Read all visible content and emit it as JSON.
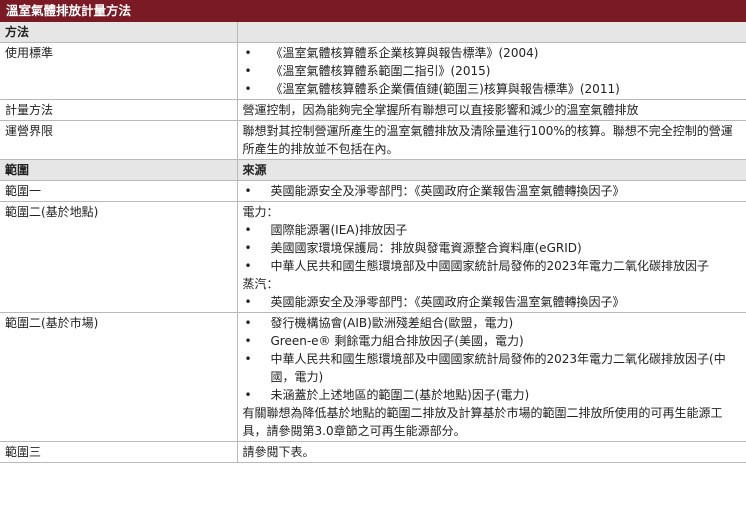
{
  "title": "溫室氣體排放計量方法",
  "sections": [
    {
      "type": "header",
      "col1": "方法",
      "col2": ""
    },
    {
      "type": "row",
      "col1": "使用標準",
      "bullets": [
        "《溫室氣體核算體系企業核算與報告標準》(2004)",
        "《溫室氣體核算體系範圍二指引》(2015)",
        "《溫室氣體核算體系企業價值鏈(範圍三)核算與報告標準》(2011)"
      ]
    },
    {
      "type": "row",
      "col1": "計量方法",
      "text": "營運控制，因為能夠完全掌握所有聯想可以直接影響和減少的溫室氣體排放"
    },
    {
      "type": "row",
      "col1": "運營界限",
      "text": "聯想對其控制營運所產生的溫室氣體排放及清除量進行100%的核算。聯想不完全控制的營運所產生的排放並不包括在內。"
    },
    {
      "type": "header",
      "col1": "範圍",
      "col2": "來源"
    },
    {
      "type": "row",
      "col1": "範圍一",
      "bullets": [
        "英國能源安全及淨零部門：《英國政府企業報告溫室氣體轉換因子》"
      ]
    },
    {
      "type": "row",
      "col1": "範圍二(基於地點)",
      "electricity_label": "電力：",
      "electricity_bullets": [
        "國際能源署(IEA)排放因子",
        "美國國家環境保護局：排放與發電資源整合資料庫(eGRID)",
        "中華人民共和國生態環境部及中國國家統計局發佈的2023年電力二氧化碳排放因子"
      ],
      "steam_label": "蒸汽：",
      "steam_bullets": [
        "英國能源安全及淨零部門：《英國政府企業報告溫室氣體轉換因子》"
      ]
    },
    {
      "type": "row",
      "col1": "範圍二(基於市場)",
      "bullets": [
        "發行機構協會(AIB)歐洲殘差組合(歐盟，電力)",
        "Green-e® 剩餘電力組合排放因子(美國，電力)",
        "中華人民共和國生態環境部及中國國家統計局發佈的2023年電力二氧化碳排放因子(中國，電力)",
        "未涵蓋於上述地區的範圍二(基於地點)因子(電力)"
      ],
      "note": "有關聯想為降低基於地點的範圍二排放及計算基於市場的範圍二排放所使用的可再生能源工具，請參閱第3.0章節之可再生能源部分。"
    },
    {
      "type": "row",
      "col1": "範圍三",
      "text": "請參閱下表。"
    }
  ]
}
